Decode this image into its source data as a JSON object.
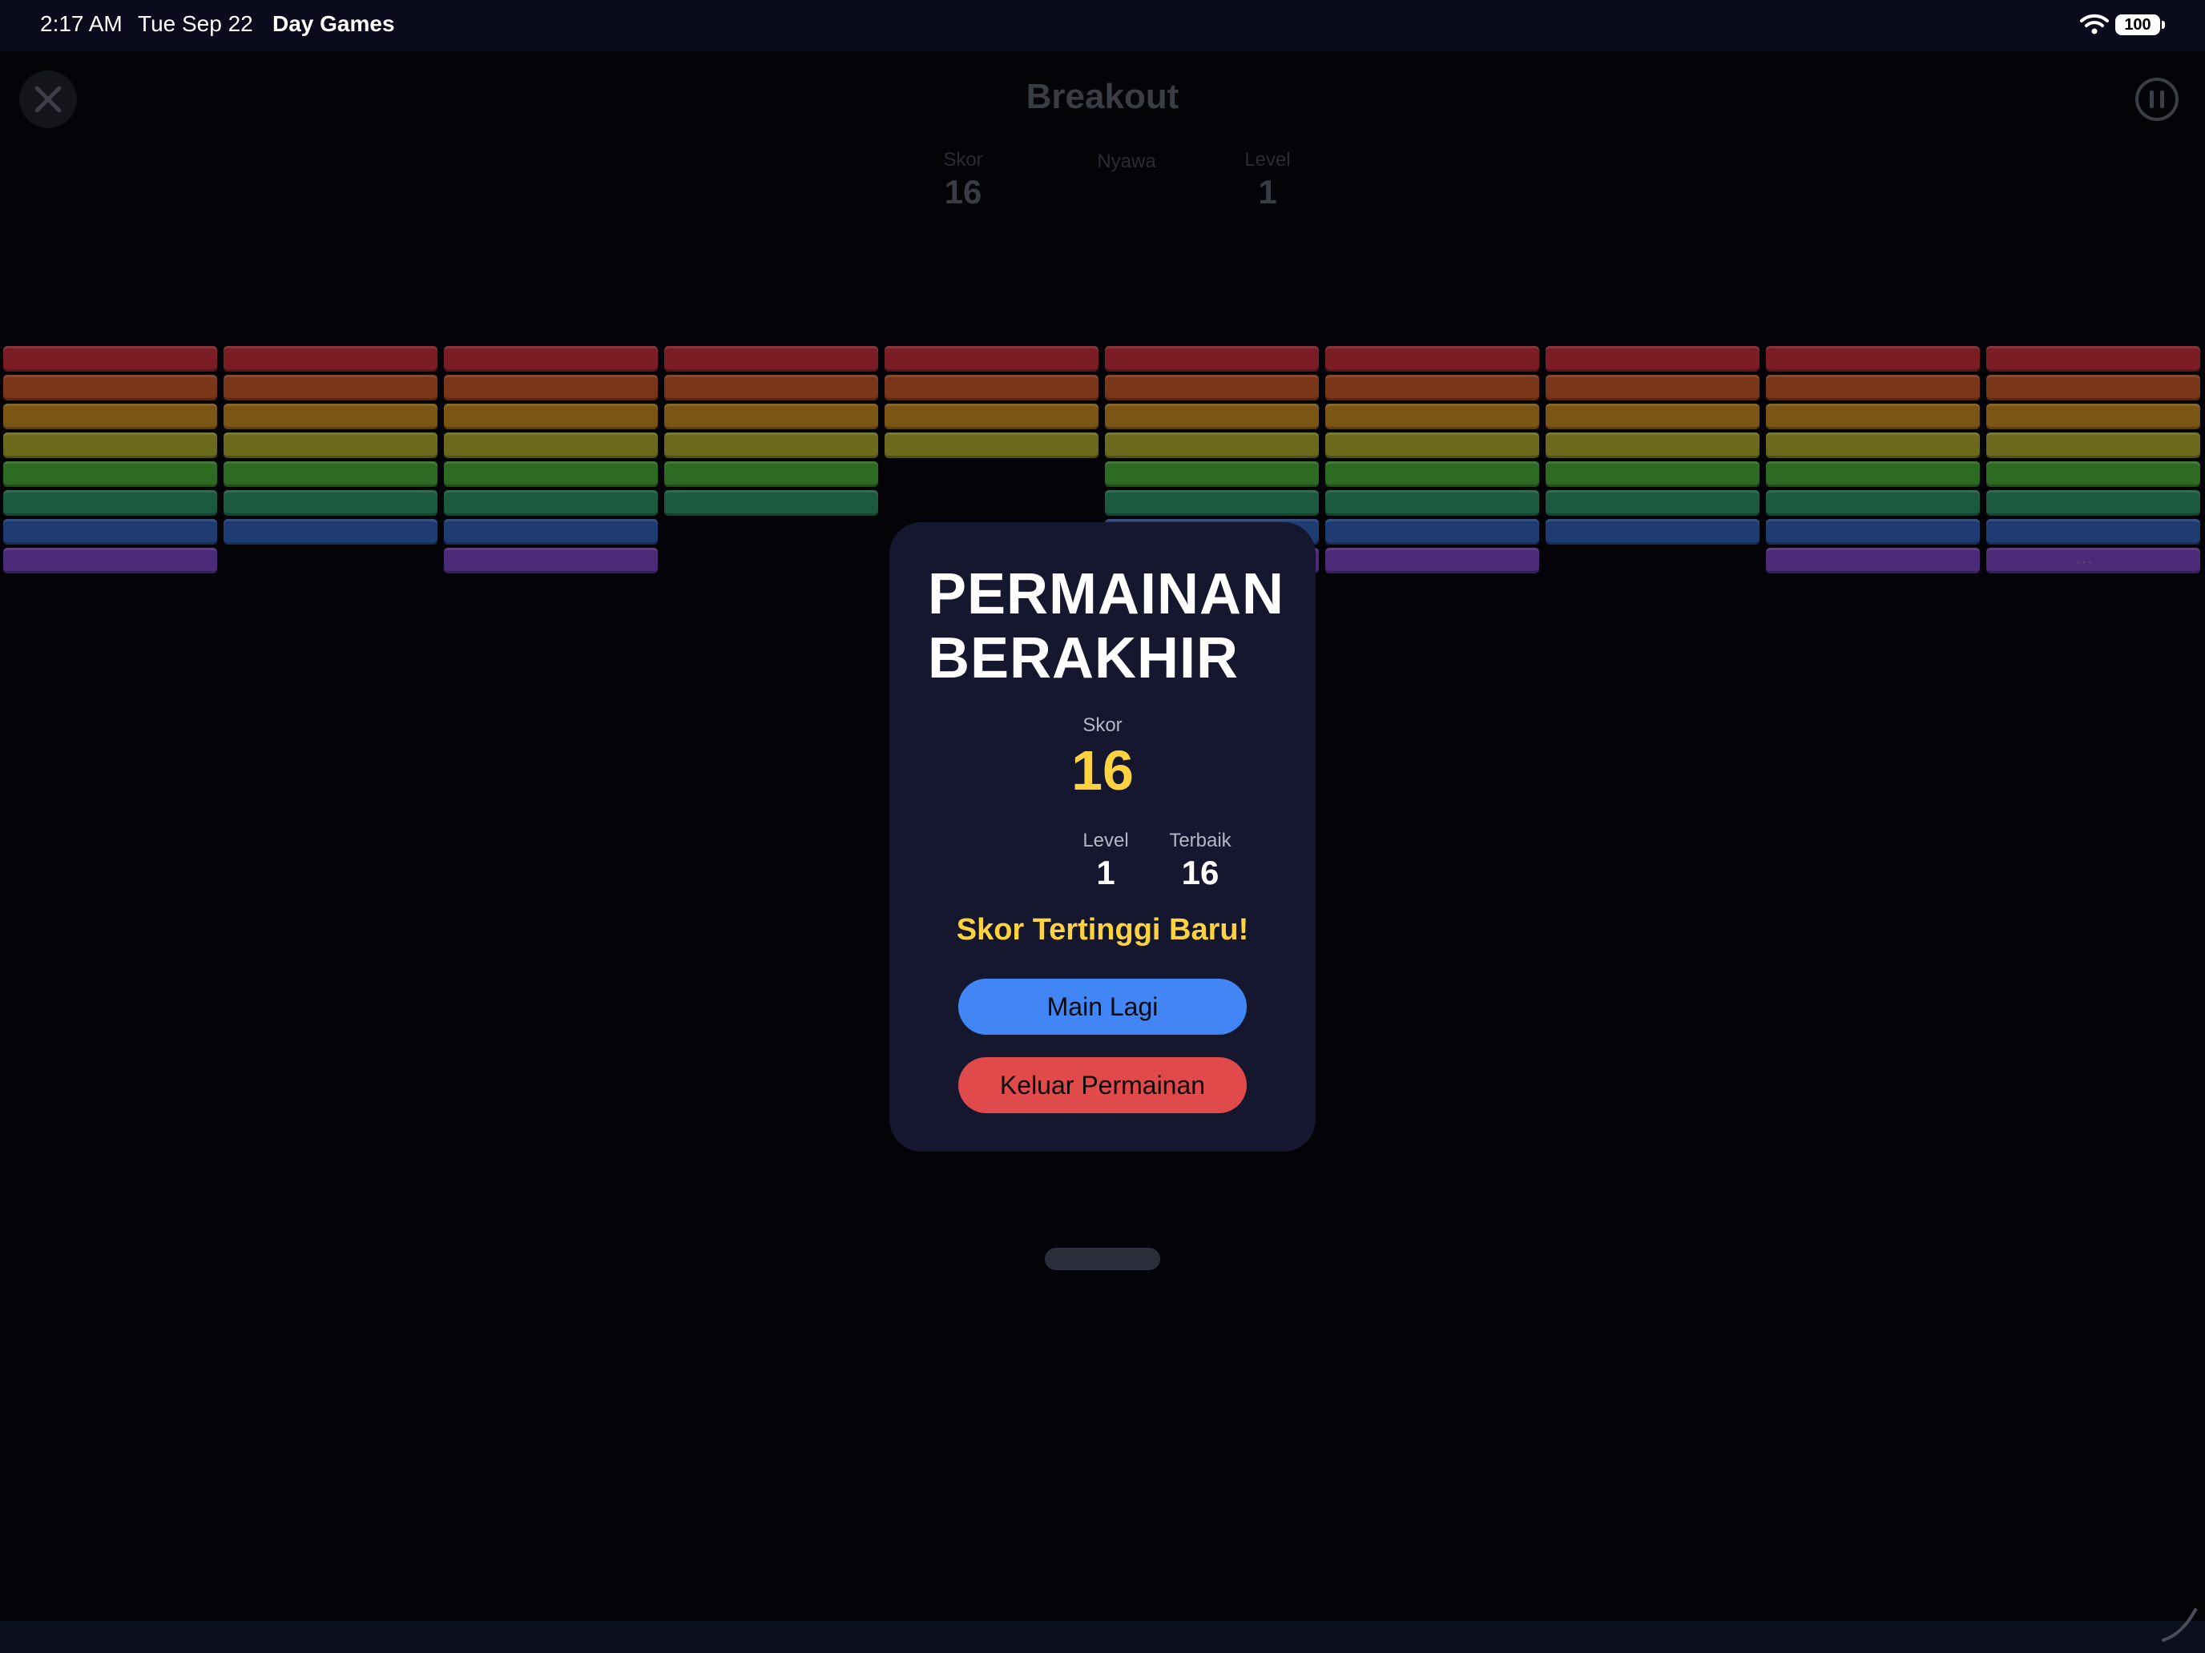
{
  "status_bar": {
    "time": "2:17 AM",
    "date": "Tue Sep 22",
    "app": "Day Games",
    "battery": "100"
  },
  "game": {
    "title": "Breakout",
    "hud": [
      {
        "label": "Skor",
        "value": "16"
      },
      {
        "label": "Nyawa",
        "value": ""
      },
      {
        "label": "Level",
        "value": "1"
      }
    ]
  },
  "bricks": {
    "row_colors": [
      "#7a1d24",
      "#7a3618",
      "#7a5514",
      "#6b6a1c",
      "#2d6a22",
      "#1c5a40",
      "#1f3c72",
      "#4b2a78"
    ],
    "rows": [
      [
        1,
        1,
        1,
        1,
        1,
        1,
        1,
        1,
        1,
        1
      ],
      [
        1,
        1,
        1,
        1,
        1,
        1,
        1,
        1,
        1,
        1
      ],
      [
        1,
        1,
        1,
        1,
        1,
        1,
        1,
        1,
        1,
        1
      ],
      [
        1,
        1,
        1,
        1,
        1,
        1,
        1,
        1,
        1,
        1
      ],
      [
        1,
        1,
        1,
        1,
        0,
        1,
        1,
        1,
        1,
        1
      ],
      [
        1,
        1,
        1,
        1,
        0,
        1,
        1,
        1,
        1,
        1
      ],
      [
        1,
        1,
        1,
        0,
        0,
        1,
        1,
        1,
        1,
        1
      ],
      [
        1,
        0,
        1,
        0,
        0,
        1,
        1,
        0,
        1,
        1
      ]
    ]
  },
  "modal": {
    "title": "PERMAINAN BERAKHIR",
    "score_label": "Skor",
    "score_value": "16",
    "level_label": "Level",
    "level_value": "1",
    "best_label": "Terbaik",
    "best_value": "16",
    "highscore_message": "Skor Tertinggi Baru!",
    "play_again": "Main Lagi",
    "exit_game": "Keluar Permainan"
  },
  "colors": {
    "accent_yellow": "#ffd23f",
    "play_button": "#4285f4",
    "exit_button": "#e04a4a",
    "modal_bg": "#15172f"
  },
  "icons": [
    "close-icon",
    "pause-icon",
    "wifi-icon",
    "battery-icon"
  ]
}
